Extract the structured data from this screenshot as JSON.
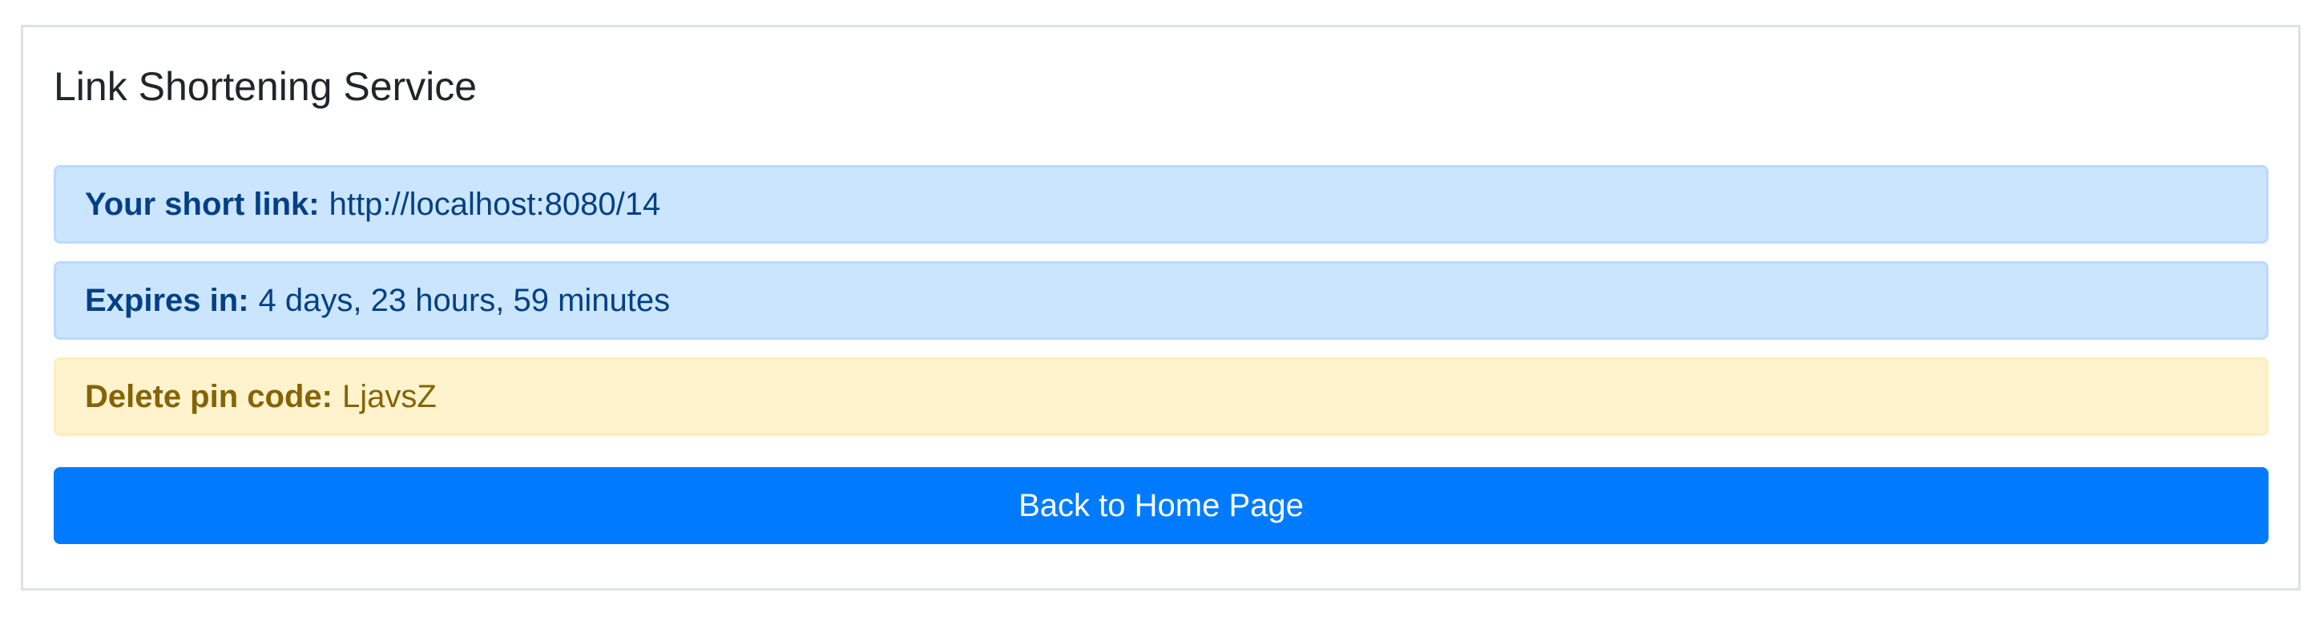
{
  "page": {
    "title": "Link Shortening Service"
  },
  "short_link": {
    "label": "Your short link:",
    "value": "http://localhost:8080/14"
  },
  "expires": {
    "label": "Expires in:",
    "value": "4 days, 23 hours, 59 minutes"
  },
  "delete_pin": {
    "label": "Delete pin code:",
    "value": "LjavsZ"
  },
  "actions": {
    "back_home_label": "Back to Home Page"
  },
  "colors": {
    "primary": "#007bff",
    "info_bg": "#cce5ff",
    "info_text": "#004085",
    "warning_bg": "#fff3cd",
    "warning_text": "#856404"
  }
}
